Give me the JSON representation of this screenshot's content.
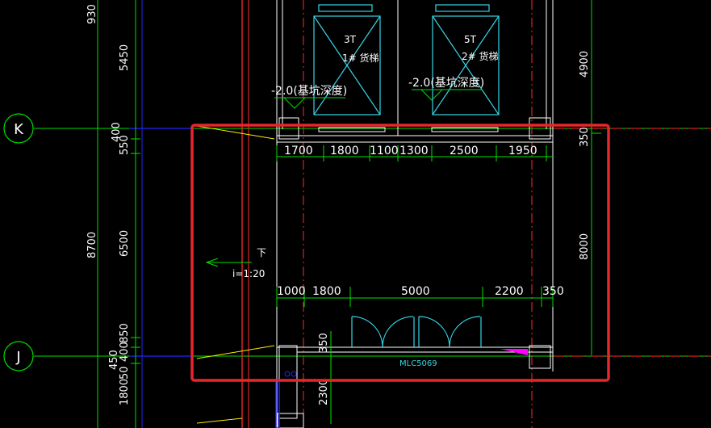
{
  "axes": {
    "k": "K",
    "j": "J"
  },
  "top_dims": [
    "1700",
    "1800",
    "1100",
    "1300",
    "2500",
    "1950"
  ],
  "bottom_dims": [
    "1000",
    "1800",
    "5000",
    "2200",
    "350"
  ],
  "vertical_dims": {
    "col1_top": "930",
    "col1_mid": "8700",
    "col1_low": "450",
    "col1_bottom": "1800",
    "col2_top": "5450",
    "col2_a": "400",
    "col2_b": "550",
    "col2_mid": "6500",
    "col2_c": "850",
    "col2_d": "400",
    "col2_e": "50",
    "right_top": "4900",
    "right_350": "350",
    "right_mid": "8000",
    "inner_350": "350",
    "inner_2300": "2300"
  },
  "elevators": [
    {
      "code": "3T",
      "name": "1# 货梯"
    },
    {
      "code": "5T",
      "name": "2# 货梯"
    }
  ],
  "pit_depth": [
    "-2.0(基坑深度)",
    "-2.0(基坑深度)"
  ],
  "ramp": {
    "direction": "下",
    "slope": "i=1:20"
  },
  "door_tag": "MLC5069",
  "colors": {
    "background": "#000000",
    "axis_line": "#00e000",
    "highlight_box": "#e8262a",
    "wall": "#ffffff",
    "red_line": "#ff2a2a",
    "cyan": "#36d6e7",
    "blue_line": "#2424ff",
    "magenta": "#ff00ff",
    "yellow": "#ffee00"
  }
}
